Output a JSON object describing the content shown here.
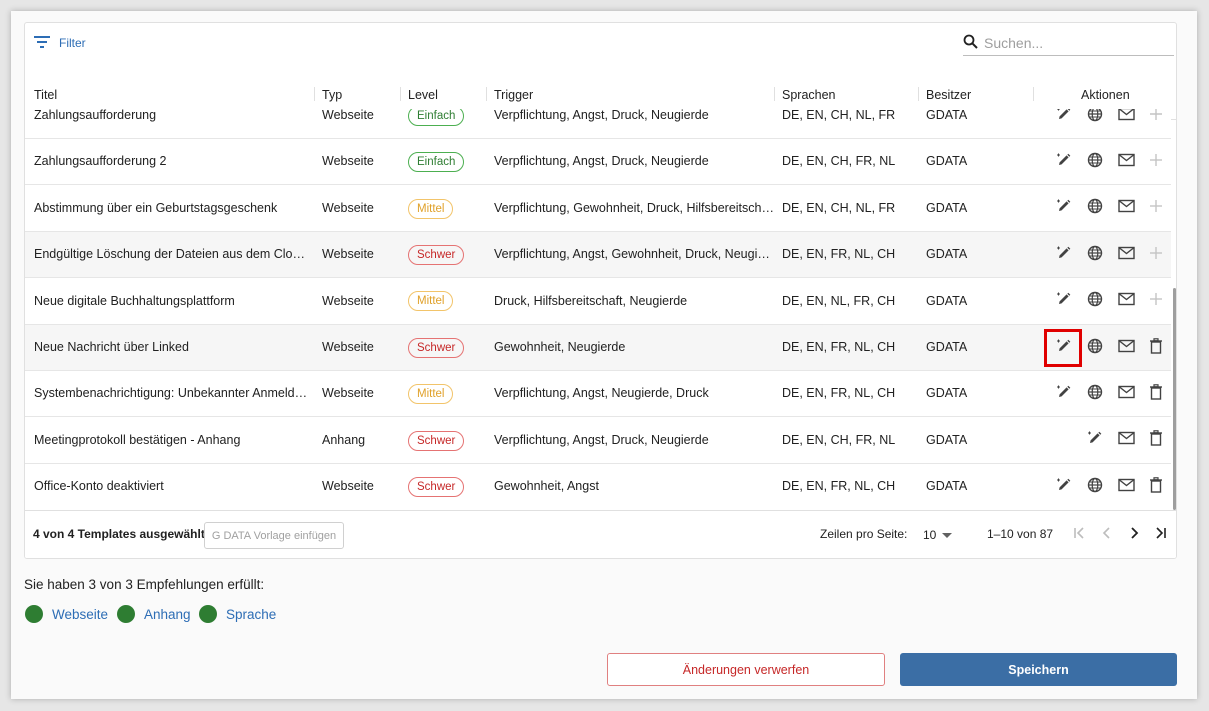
{
  "toolbar": {
    "filter_label": "Filter",
    "search_placeholder": "Suchen..."
  },
  "table": {
    "columns": [
      "Titel",
      "Typ",
      "Level",
      "Trigger",
      "Sprachen",
      "Besitzer",
      "Aktionen"
    ],
    "rows": [
      {
        "title": "Zahlungsaufforderung",
        "type": "Webseite",
        "level": "Einfach",
        "trigger": "Verpflichtung, Angst, Druck, Neugierde",
        "languages": "DE, EN, CH, NL, FR",
        "owner": "GDATA",
        "last_action": "plus"
      },
      {
        "title": "Zahlungsaufforderung 2",
        "type": "Webseite",
        "level": "Einfach",
        "trigger": "Verpflichtung, Angst, Druck, Neugierde",
        "languages": "DE, EN, CH, FR, NL",
        "owner": "GDATA",
        "last_action": "plus"
      },
      {
        "title": "Abstimmung über ein Geburtstagsgeschenk",
        "type": "Webseite",
        "level": "Mittel",
        "trigger": "Verpflichtung, Gewohnheit, Druck, Hilfsbereitschaft,",
        "languages": "DE, EN, CH, NL, FR",
        "owner": "GDATA",
        "last_action": "plus"
      },
      {
        "title": "Endgültige Löschung der Dateien aus dem Clou…",
        "type": "Webseite",
        "level": "Schwer",
        "trigger": "Verpflichtung, Angst, Gewohnheit, Druck, Neugierde",
        "languages": "DE, EN, FR, NL, CH",
        "owner": "GDATA",
        "last_action": "plus"
      },
      {
        "title": "Neue digitale Buchhaltungsplattform",
        "type": "Webseite",
        "level": "Mittel",
        "trigger": "Druck, Hilfsbereitschaft, Neugierde",
        "languages": "DE, EN, NL, FR, CH",
        "owner": "GDATA",
        "last_action": "plus"
      },
      {
        "title": "Neue Nachricht über Linked",
        "type": "Webseite",
        "level": "Schwer",
        "trigger": "Gewohnheit, Neugierde",
        "languages": "DE, EN, FR, NL, CH",
        "owner": "GDATA",
        "last_action": "trash"
      },
      {
        "title": "Systembenachrichtigung: Unbekannter Anmeld…",
        "type": "Webseite",
        "level": "Mittel",
        "trigger": "Verpflichtung, Angst, Neugierde, Druck",
        "languages": "DE, EN, FR, NL, CH",
        "owner": "GDATA",
        "last_action": "trash"
      },
      {
        "title": "Meetingprotokoll bestätigen - Anhang",
        "type": "Anhang",
        "level": "Schwer",
        "trigger": "Verpflichtung, Angst, Druck, Neugierde",
        "languages": "DE, EN, CH, FR, NL",
        "owner": "GDATA",
        "last_action": "trash"
      },
      {
        "title": "Office-Konto deaktiviert",
        "type": "Webseite",
        "level": "Schwer",
        "trigger": "Gewohnheit, Angst",
        "languages": "DE, EN, FR, NL, CH",
        "owner": "GDATA",
        "last_action": "trash"
      }
    ]
  },
  "footer": {
    "selected_text": "4 von 4 Templates ausgewählt",
    "insert_label": "G DATA Vorlage einfügen",
    "rows_per_page_label": "Zeilen pro Seite:",
    "rows_per_page_value": "10",
    "range_text": "1–10 von 87"
  },
  "recommendations": {
    "text": "Sie haben 3 von 3 Empfehlungen erfüllt:",
    "items": [
      {
        "label": "Webseite",
        "color": "#2e7d32"
      },
      {
        "label": "Anhang",
        "color": "#2e7d32"
      },
      {
        "label": "Sprache",
        "color": "#2e7d32"
      }
    ]
  },
  "actions": {
    "discard_label": "Änderungen verwerfen",
    "save_label": "Speichern"
  },
  "colors": {
    "accent": "#2d6db5",
    "primary_button": "#3b6ea5",
    "easy": "#2e7d32",
    "medium": "#e0a12a",
    "hard": "#c62828",
    "highlight_box": "#e00000"
  }
}
